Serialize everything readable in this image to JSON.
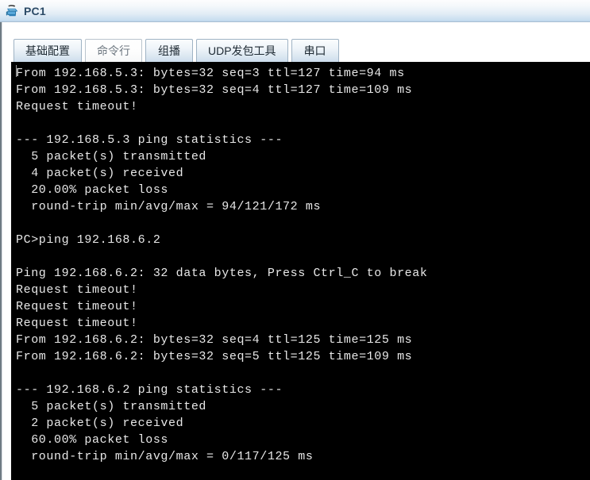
{
  "window": {
    "title": "PC1",
    "icon": "pc-device-icon"
  },
  "tabs": [
    {
      "label": "基础配置",
      "active": false,
      "name": "tab-basic-config"
    },
    {
      "label": "命令行",
      "active": true,
      "name": "tab-command-line"
    },
    {
      "label": "组播",
      "active": false,
      "name": "tab-multicast"
    },
    {
      "label": "UDP发包工具",
      "active": false,
      "name": "tab-udp-sender"
    },
    {
      "label": "串口",
      "active": false,
      "name": "tab-serial-port"
    }
  ],
  "terminal": {
    "lines": [
      "From 192.168.5.3: bytes=32 seq=3 ttl=127 time=94 ms",
      "From 192.168.5.3: bytes=32 seq=4 ttl=127 time=109 ms",
      "Request timeout!",
      "",
      "--- 192.168.5.3 ping statistics ---",
      "  5 packet(s) transmitted",
      "  4 packet(s) received",
      "  20.00% packet loss",
      "  round-trip min/avg/max = 94/121/172 ms",
      "",
      "PC>ping 192.168.6.2",
      "",
      "Ping 192.168.6.2: 32 data bytes, Press Ctrl_C to break",
      "Request timeout!",
      "Request timeout!",
      "Request timeout!",
      "From 192.168.6.2: bytes=32 seq=4 ttl=125 time=125 ms",
      "From 192.168.6.2: bytes=32 seq=5 ttl=125 time=109 ms",
      "",
      "--- 192.168.6.2 ping statistics ---",
      "  5 packet(s) transmitted",
      "  2 packet(s) received",
      "  60.00% packet loss",
      "  round-trip min/avg/max = 0/117/125 ms"
    ]
  },
  "colors": {
    "titlebar_top": "#fdfdfe",
    "titlebar_bottom": "#bcd6ec",
    "title_text": "#2b4a66",
    "terminal_bg": "#000000",
    "terminal_fg": "#e8e8e8",
    "tab_border": "#9fb3c4"
  }
}
